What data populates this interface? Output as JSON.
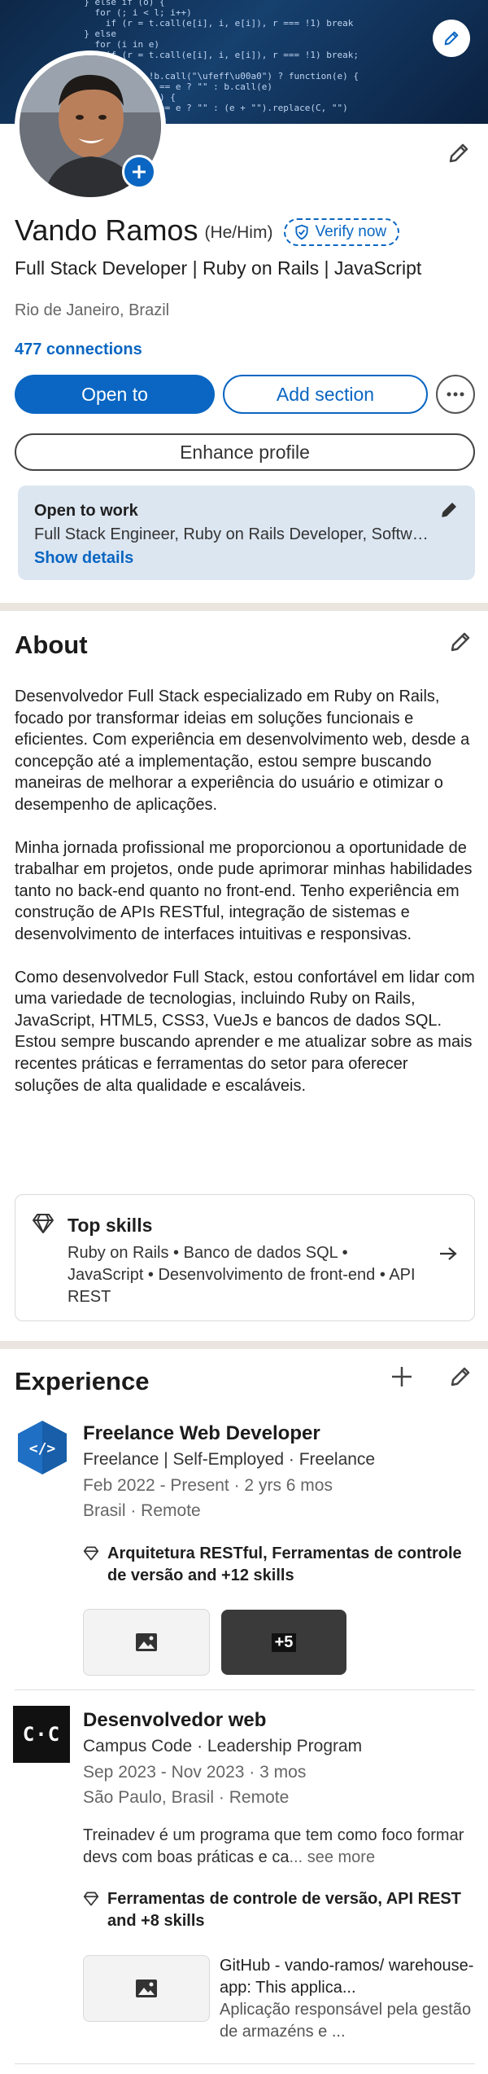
{
  "banner": {
    "code_lines": [
      "  } else if (o) {",
      "    for (; i < l; i++)",
      "      if (r = t.call(e[i], i, e[i]), r === !1) break",
      "  } else",
      "    for (i in e)",
      "      if (r = t.call(e[i], i, e[i]), r === !1) break;",
      "  return e",
      "}, trim: b && !b.call(\"\\ufeff\\u00a0\") ? function(e) {",
      "    return null == e ? \"\" : b.call(e)",
      "  } : function(e) {",
      "    return null == e ? \"\" : (e + \"\").replace(C, \"\")"
    ]
  },
  "profile": {
    "name": "Vando Ramos",
    "pronouns": "(He/Him)",
    "verify_label": "Verify now",
    "headline": "Full Stack Developer | Ruby on Rails | JavaScript",
    "location": "Rio de Janeiro, Brazil",
    "connections": "477 connections"
  },
  "actions": {
    "open_to": "Open to",
    "add_section": "Add section",
    "enhance_profile": "Enhance profile"
  },
  "open_to_work": {
    "title": "Open to work",
    "description": "Full Stack Engineer, Ruby on Rails Developer, Software Engineer",
    "link": "Show details"
  },
  "about": {
    "title": "About",
    "paragraphs": [
      "Desenvolvedor Full Stack especializado em Ruby on Rails, focado por transformar ideias em soluções funcionais e eficientes. Com experiência em desenvolvimento web, desde a concepção até a implementação, estou sempre buscando maneiras de melhorar a experiência do usuário e otimizar o desempenho de aplicações.",
      "Minha jornada profissional me proporcionou a oportunidade de trabalhar em projetos, onde pude aprimorar minhas habilidades tanto no back-end quanto no front-end. Tenho experiência em construção de APIs RESTful, integração de sistemas e desenvolvimento de interfaces intuitivas e responsivas.",
      "Como desenvolvedor Full Stack, estou confortável em lidar com uma variedade de tecnologias, incluindo Ruby on Rails, JavaScript, HTML5, CSS3, VueJs e bancos de dados SQL. Estou sempre buscando aprender e me atualizar sobre as mais recentes práticas e ferramentas do setor para oferecer soluções de alta qualidade e escaláveis."
    ],
    "top_skills": {
      "title": "Top skills",
      "skills": "Ruby on Rails • Banco de dados SQL • JavaScript • Desenvolvimento de front-end • API REST"
    }
  },
  "experience": {
    "title": "Experience",
    "jobs": [
      {
        "logo_text": "</>",
        "title": "Freelance Web Developer",
        "company": "Freelance | Self-Employed · Freelance",
        "dates": "Feb 2022 - Present · 2 yrs 6 mos",
        "location": "Brasil · Remote",
        "skills": "Arquitetura RESTful, Ferramentas de controle de versão and +12 skills",
        "media_more": "+5"
      },
      {
        "logo_text": "C·C",
        "title": "Desenvolvedor web",
        "company": "Campus Code · Leadership Program",
        "dates": "Sep 2023 - Nov 2023 · 3 mos",
        "location": "São Paulo, Brasil · Remote",
        "description": "Treinadev é um programa que tem como foco formar devs com boas práticas e ca",
        "see_more": "... see more",
        "skills": "Ferramentas de controle de versão, API REST and +8 skills",
        "media_title": "GitHub - vando-ramos/ warehouse-app: This applica...",
        "media_desc": "Aplicação responsável pela gestão de armazéns e ..."
      }
    ]
  },
  "colors": {
    "accent": "#0a66c2",
    "open_to_work_bg": "#dce6f1",
    "divider": "#eae6df"
  }
}
